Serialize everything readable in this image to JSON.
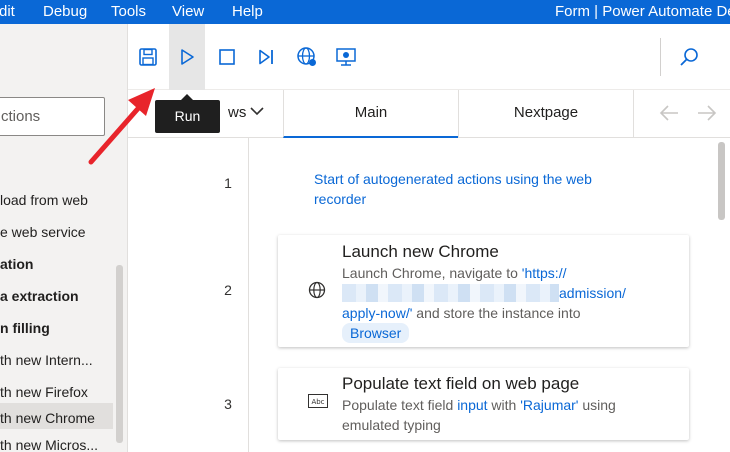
{
  "menu": {
    "edit": "dit",
    "debug": "Debug",
    "tools": "Tools",
    "view": "View",
    "help": "Help"
  },
  "window_title": "Form | Power Automate De",
  "actions_pane": {
    "search_placeholder": "ctions",
    "items": [
      {
        "label": "load from web",
        "group": false
      },
      {
        "label": "e web service",
        "group": false
      },
      {
        "label": "ation",
        "group": true
      },
      {
        "label": "a extraction",
        "group": true
      },
      {
        "label": "n filling",
        "group": true
      },
      {
        "label": "th new Intern...",
        "group": false
      },
      {
        "label": "th new Firefox",
        "group": false
      },
      {
        "label": "th new Chrome",
        "group": false,
        "selected": true
      },
      {
        "label": "th new Micros...",
        "group": false
      }
    ]
  },
  "toolbar": {
    "save_icon": "save-icon",
    "run_icon": "run-icon",
    "stop_icon": "stop-icon",
    "next_icon": "run-next-action-icon",
    "web_recorder_icon": "web-recorder-icon",
    "desktop_recorder_icon": "desktop-recorder-icon",
    "search_icon": "search-icon",
    "run_tooltip": "Run"
  },
  "tabs": {
    "subflows_label": "ws",
    "items": [
      {
        "label": "Main",
        "active": true
      },
      {
        "label": "Nextpage",
        "active": false
      }
    ]
  },
  "flow": {
    "comment": "Start of autogenerated actions using the web recorder",
    "lines": [
      "1",
      "2",
      "3"
    ],
    "steps": [
      {
        "title": "Launch new Chrome",
        "desc_prefix": "Launch Chrome, navigate to ",
        "url_start": "'https://",
        "url_end": "admission/",
        "url_tail": "apply-now/'",
        "desc_mid": " and store the instance into",
        "variable": "Browser",
        "icon": "globe-icon"
      },
      {
        "title": "Populate text field on web page",
        "desc_prefix": "Populate text field ",
        "field": "input",
        "desc_mid": " with ",
        "value": "'Rajumar'",
        "desc_suffix": " using",
        "desc_line2": "emulated typing",
        "icon": "text-field-icon"
      }
    ]
  },
  "colors": {
    "brand": "#0a68d6",
    "annotation_arrow": "#e8242b"
  }
}
